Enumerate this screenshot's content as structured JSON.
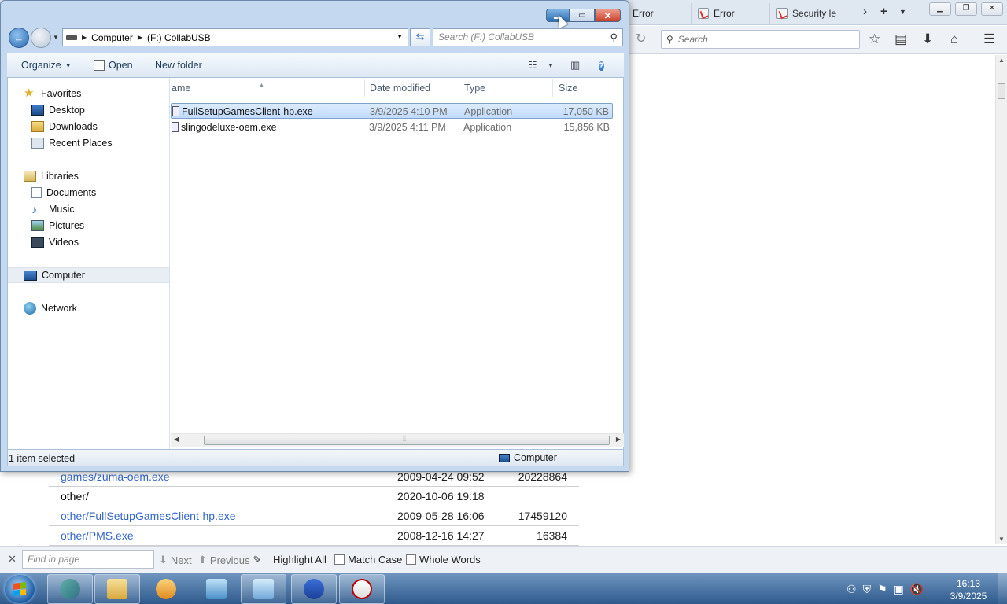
{
  "browser": {
    "tabs": [
      {
        "label": "Error"
      },
      {
        "label": "Error"
      },
      {
        "label": "Security le"
      }
    ],
    "new_tab_symbol": "+",
    "search_placeholder": "Search",
    "listing": [
      {
        "name": "games/zuma-oem.exe",
        "date": "2009-04-24 09:52",
        "size": "20228864",
        "link": true
      },
      {
        "name": "other/",
        "date": "2020-10-06 19:18",
        "size": "",
        "link": false
      },
      {
        "name": "other/FullSetupGamesClient-hp.exe",
        "date": "2009-05-28 16:06",
        "size": "17459120",
        "link": true
      },
      {
        "name": "other/PMS.exe",
        "date": "2008-12-16 14:27",
        "size": "16384",
        "link": true
      }
    ],
    "findbar": {
      "placeholder": "Find in page",
      "next": "Next",
      "previous": "Previous",
      "highlight_all": "Highlight All",
      "match_case": "Match Case",
      "whole_words": "Whole Words"
    }
  },
  "explorer": {
    "breadcrumb": [
      "Computer",
      "(F:) CollabUSB"
    ],
    "search_placeholder": "Search (F:) CollabUSB",
    "toolbar": {
      "organize": "Organize",
      "open": "Open",
      "new_folder": "New folder"
    },
    "nav": {
      "favorites": "Favorites",
      "desktop": "Desktop",
      "downloads": "Downloads",
      "recent": "Recent Places",
      "libraries": "Libraries",
      "documents": "Documents",
      "music": "Music",
      "pictures": "Pictures",
      "videos": "Videos",
      "computer": "Computer",
      "network": "Network"
    },
    "columns": {
      "name": "ame",
      "date": "Date modified",
      "type": "Type",
      "size": "Size"
    },
    "files": [
      {
        "name": "FullSetupGamesClient-hp.exe",
        "date": "3/9/2025 4:10 PM",
        "type": "Application",
        "size": "17,050 KB",
        "selected": true
      },
      {
        "name": "slingodeluxe-oem.exe",
        "date": "3/9/2025 4:11 PM",
        "type": "Application",
        "size": "15,856 KB",
        "selected": false
      }
    ],
    "status": {
      "selection": "1 item selected",
      "location": "Computer"
    }
  },
  "taskbar": {
    "clock_time": "16:13",
    "clock_date": "3/9/2025"
  },
  "colors": {
    "link": "#3366cc",
    "selection": "#c1dbfc",
    "taskbar": "#2e5a8c"
  }
}
